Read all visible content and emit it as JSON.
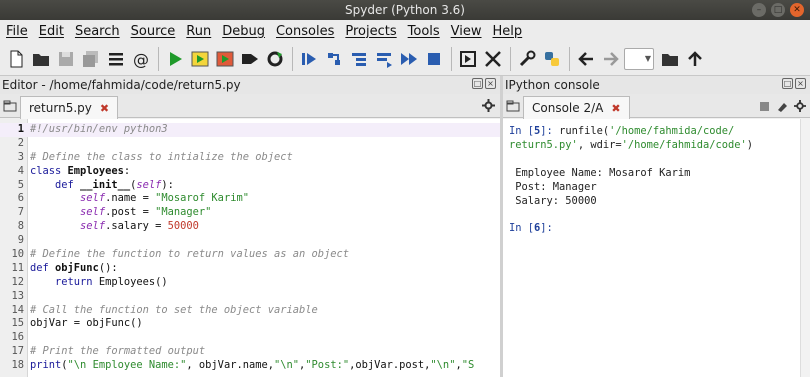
{
  "window": {
    "title": "Spyder (Python 3.6)"
  },
  "menu": [
    "File",
    "Edit",
    "Search",
    "Source",
    "Run",
    "Debug",
    "Consoles",
    "Projects",
    "Tools",
    "View",
    "Help"
  ],
  "toolbar": {
    "icons": [
      "new-file-icon",
      "open-file-icon",
      "save-icon",
      "save-all-icon",
      "list-icon",
      "at-icon",
      "run-icon",
      "run-cell-icon",
      "run-cell-advance-icon",
      "run-selection-icon",
      "rerun-icon",
      "debug-icon",
      "step-icon",
      "step-into-icon",
      "step-return-icon",
      "continue-icon",
      "stop-icon",
      "maximize-pane-icon",
      "fullscreen-icon",
      "preferences-icon",
      "python-path-icon",
      "back-icon",
      "forward-icon",
      "working-dir-icon",
      "up-dir-icon"
    ]
  },
  "editor": {
    "pane_title": "Editor - /home/fahmida/code/return5.py",
    "tab_label": "return5.py",
    "lines": [
      {
        "n": "1",
        "parts": [
          {
            "t": "#!/usr/bin/env python3",
            "c": "cmt"
          }
        ]
      },
      {
        "n": "2",
        "parts": []
      },
      {
        "n": "3",
        "parts": [
          {
            "t": "# Define the class to intialize the object",
            "c": "cmt"
          }
        ]
      },
      {
        "n": "4",
        "parts": [
          {
            "t": "class ",
            "c": "kw"
          },
          {
            "t": "Employees",
            "c": "fn"
          },
          {
            "t": ":",
            "c": ""
          }
        ]
      },
      {
        "n": "5",
        "parts": [
          {
            "t": "    def ",
            "c": "kw"
          },
          {
            "t": "__init__",
            "c": "fn"
          },
          {
            "t": "(",
            "c": ""
          },
          {
            "t": "self",
            "c": "self"
          },
          {
            "t": "):",
            "c": ""
          }
        ]
      },
      {
        "n": "6",
        "parts": [
          {
            "t": "        ",
            "c": ""
          },
          {
            "t": "self",
            "c": "self"
          },
          {
            "t": ".name = ",
            "c": ""
          },
          {
            "t": "\"Mosarof Karim\"",
            "c": "str"
          }
        ]
      },
      {
        "n": "7",
        "parts": [
          {
            "t": "        ",
            "c": ""
          },
          {
            "t": "self",
            "c": "self"
          },
          {
            "t": ".post = ",
            "c": ""
          },
          {
            "t": "\"Manager\"",
            "c": "str"
          }
        ]
      },
      {
        "n": "8",
        "parts": [
          {
            "t": "        ",
            "c": ""
          },
          {
            "t": "self",
            "c": "self"
          },
          {
            "t": ".salary = ",
            "c": ""
          },
          {
            "t": "50000",
            "c": "num"
          }
        ]
      },
      {
        "n": "9",
        "parts": []
      },
      {
        "n": "10",
        "parts": [
          {
            "t": "# Define the function to return values as an object",
            "c": "cmt"
          }
        ]
      },
      {
        "n": "11",
        "parts": [
          {
            "t": "def ",
            "c": "kw"
          },
          {
            "t": "objFunc",
            "c": "fn"
          },
          {
            "t": "():",
            "c": ""
          }
        ]
      },
      {
        "n": "12",
        "parts": [
          {
            "t": "    return ",
            "c": "kw"
          },
          {
            "t": "Employees()",
            "c": ""
          }
        ]
      },
      {
        "n": "13",
        "parts": []
      },
      {
        "n": "14",
        "parts": [
          {
            "t": "# Call the function to set the object variable",
            "c": "cmt"
          }
        ]
      },
      {
        "n": "15",
        "parts": [
          {
            "t": "objVar = objFunc()",
            "c": ""
          }
        ]
      },
      {
        "n": "16",
        "parts": []
      },
      {
        "n": "17",
        "parts": [
          {
            "t": "# Print the formatted output",
            "c": "cmt"
          }
        ]
      },
      {
        "n": "18",
        "parts": [
          {
            "t": "print",
            "c": "kw"
          },
          {
            "t": "(",
            "c": ""
          },
          {
            "t": "\"\\n Employee Name:\"",
            "c": "str"
          },
          {
            "t": ", objVar.name,",
            "c": ""
          },
          {
            "t": "\"\\n\"",
            "c": "str"
          },
          {
            "t": ",",
            "c": ""
          },
          {
            "t": "\"Post:\"",
            "c": "str"
          },
          {
            "t": ",objVar.post,",
            "c": ""
          },
          {
            "t": "\"\\n\"",
            "c": "str"
          },
          {
            "t": ",",
            "c": ""
          },
          {
            "t": "\"S",
            "c": "str"
          }
        ]
      }
    ]
  },
  "console": {
    "pane_title": "IPython console",
    "tab_label": "Console 2/A",
    "in5_prefix": "In [",
    "in5_num": "5",
    "in5_suffix": "]: ",
    "in5_cmd_a": "runfile(",
    "in5_str_a": "'/home/fahmida/code/",
    "in5_str_b": "return5.py'",
    "in5_cmd_b": ", wdir=",
    "in5_str_c": "'/home/fahmida/code'",
    "in5_cmd_c": ")",
    "output": [
      " Employee Name: Mosarof Karim",
      " Post: Manager",
      " Salary: 50000"
    ],
    "in6_prefix": "In [",
    "in6_num": "6",
    "in6_suffix": "]: "
  }
}
